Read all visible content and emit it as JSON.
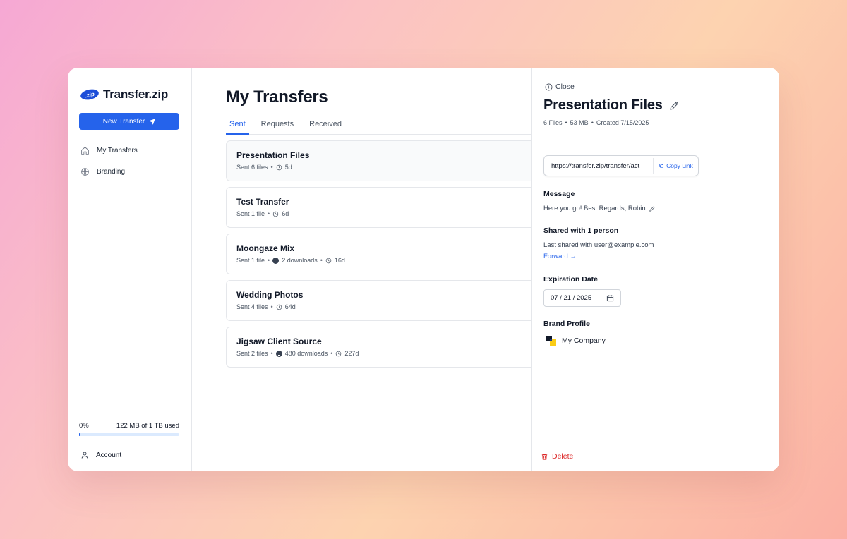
{
  "app": {
    "logo_mark": ".zip",
    "logo_text": "Transfer.zip",
    "accent_color": "#2563eb",
    "danger_color": "#dc2626"
  },
  "sidebar": {
    "new_transfer_label": "New Transfer",
    "nav": [
      {
        "label": "My Transfers",
        "icon": "home-icon"
      },
      {
        "label": "Branding",
        "icon": "globe-icon"
      }
    ],
    "usage": {
      "percent_label": "0%",
      "used_label": "122 MB of 1 TB used",
      "fill_fraction": 0.0012
    },
    "account_label": "Account"
  },
  "main": {
    "title": "My Transfers",
    "tabs": [
      {
        "label": "Sent",
        "active": true
      },
      {
        "label": "Requests",
        "active": false
      },
      {
        "label": "Received",
        "active": false
      }
    ],
    "transfers": [
      {
        "title": "Presentation Files",
        "sent": "Sent 6 files",
        "downloads": "",
        "age": "5d",
        "selected": true
      },
      {
        "title": "Test Transfer",
        "sent": "Sent 1 file",
        "downloads": "",
        "age": "6d",
        "selected": false
      },
      {
        "title": "Moongaze Mix",
        "sent": "Sent 1 file",
        "downloads": "2 downloads",
        "age": "16d",
        "selected": false
      },
      {
        "title": "Wedding Photos",
        "sent": "Sent 4 files",
        "downloads": "",
        "age": "64d",
        "selected": false
      },
      {
        "title": "Jigsaw Client Source",
        "sent": "Sent 2 files",
        "downloads": "480 downloads",
        "age": "227d",
        "selected": false
      }
    ]
  },
  "panel": {
    "close_label": "Close",
    "title": "Presentation Files",
    "files": "6 Files",
    "size": "53 MB",
    "created": "Created 7/15/2025",
    "link_url": "https://transfer.zip/transfer/act",
    "copy_label": "Copy Link",
    "message_label": "Message",
    "message_text": "Here you go! Best Regards, Robin",
    "shared_label": "Shared with 1 person",
    "shared_text": "Last shared with user@example.com",
    "forward_label": "Forward →",
    "expiration_label": "Expiration Date",
    "expiration_value": "07 / 21 / 2025",
    "brand_label": "Brand Profile",
    "brand_name": "My Company",
    "delete_label": "Delete"
  }
}
